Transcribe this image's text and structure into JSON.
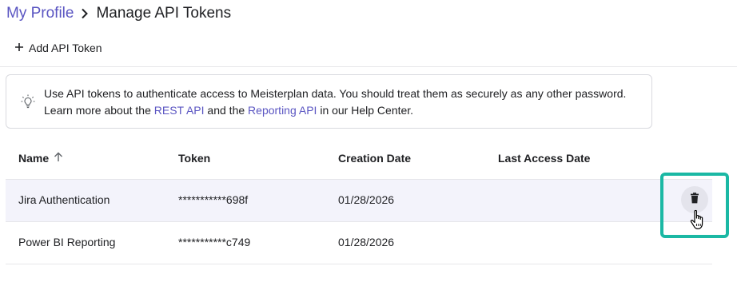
{
  "breadcrumb": {
    "parent": "My Profile",
    "current": "Manage API Tokens"
  },
  "toolbar": {
    "add_label": "Add API Token"
  },
  "info": {
    "text_1": "Use API tokens to authenticate access to Meisterplan data. You should treat them as securely as any other password.",
    "text_2_prefix": "Learn more about the ",
    "link_rest": "REST API",
    "text_2_middle": " and the ",
    "link_reporting": "Reporting API",
    "text_2_suffix": " in our Help Center."
  },
  "table": {
    "columns": {
      "name": "Name",
      "token": "Token",
      "creation_date": "Creation Date",
      "last_access_date": "Last Access Date"
    },
    "sort": {
      "column": "name",
      "direction": "ascending"
    },
    "rows": [
      {
        "name": "Jira Authentication",
        "token": "***********698f",
        "creation_date": "01/28/2026",
        "last_access_date": ""
      },
      {
        "name": "Power BI Reporting",
        "token": "***********c749",
        "creation_date": "01/28/2026",
        "last_access_date": ""
      }
    ]
  },
  "colors": {
    "link": "#5a55c2",
    "highlight": "#1bb8a4",
    "row_hover": "#f3f3fb"
  }
}
